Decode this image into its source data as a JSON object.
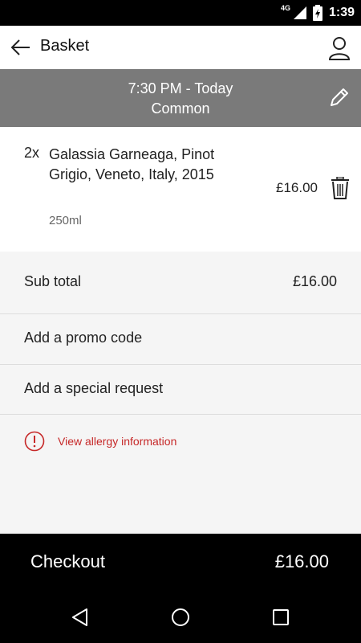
{
  "status_bar": {
    "network": "4G",
    "time": "1:39"
  },
  "app_bar": {
    "title": "Basket",
    "back_icon": "arrow-left-icon",
    "profile_icon": "person-icon"
  },
  "booking": {
    "time": "7:30 PM - Today",
    "location": "Common",
    "edit_icon": "pencil-icon"
  },
  "basket_item": {
    "quantity": "2x",
    "name": "Galassia Garneaga, Pinot Grigio, Veneto, Italy, 2015",
    "size": "250ml",
    "price": "£16.00",
    "delete_icon": "trash-icon"
  },
  "summary": {
    "subtotal_label": "Sub total",
    "subtotal_value": "£16.00",
    "promo_label": "Add a promo code",
    "request_label": "Add a special request"
  },
  "allergy": {
    "label": "View allergy information",
    "icon": "alert-circle-icon",
    "color": "#c62828"
  },
  "checkout": {
    "label": "Checkout",
    "total": "£16.00"
  },
  "nav": {
    "back": "nav-back-icon",
    "home": "nav-home-icon",
    "recents": "nav-recents-icon"
  }
}
